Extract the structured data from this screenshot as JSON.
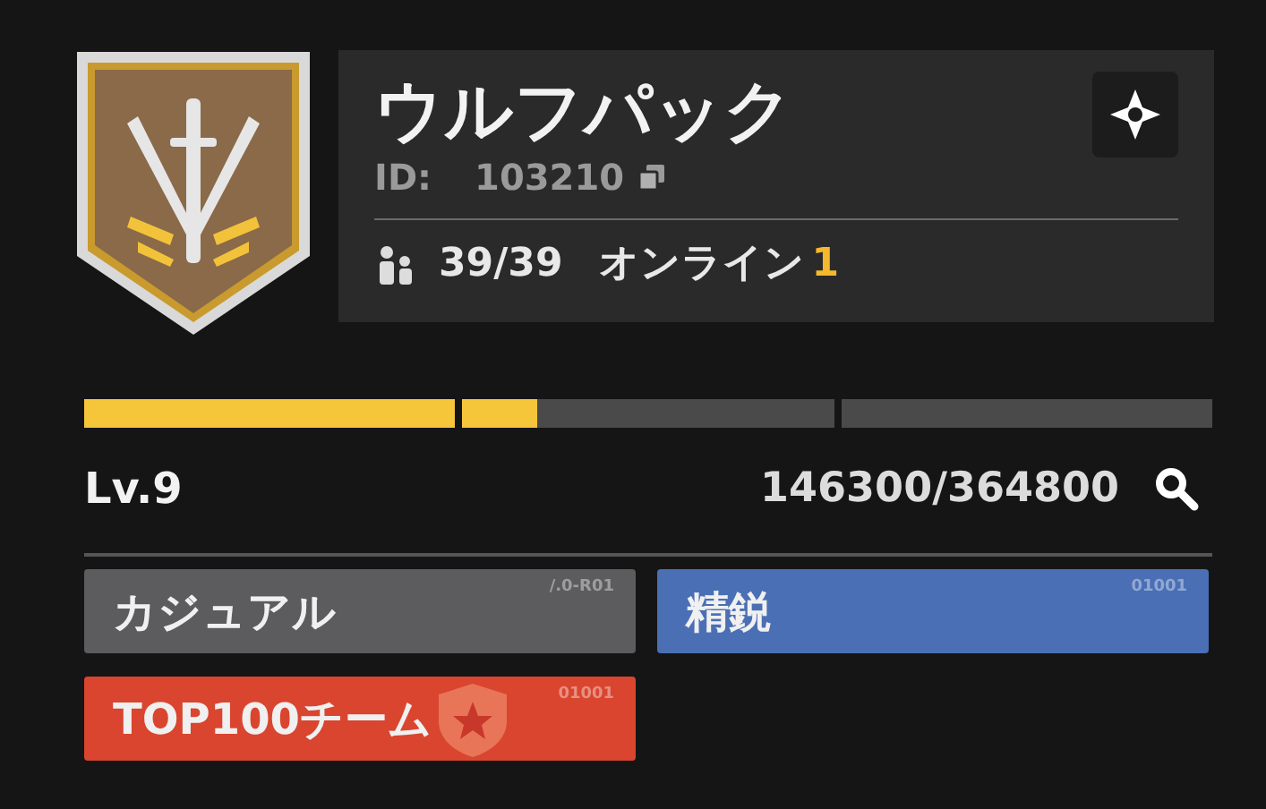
{
  "clan": {
    "name": "ウルフパック",
    "id_label": "ID:",
    "id_value": "103210",
    "members": "39/39",
    "online_label": "オンライン",
    "online_count": "1"
  },
  "progress": {
    "level": 0.401,
    "level_label": "Lv.9",
    "reading": "146300/364800"
  },
  "tags": [
    {
      "label": "カジュアル",
      "code": "/.0-R01",
      "color": "#5c5c5e",
      "kind": "plain"
    },
    {
      "label": "精鋭",
      "code": "01001",
      "color": "#4a6fb5",
      "kind": "plain"
    },
    {
      "label": "TOP100チーム",
      "code": "01001",
      "color": "#d9452f",
      "kind": "star"
    }
  ]
}
